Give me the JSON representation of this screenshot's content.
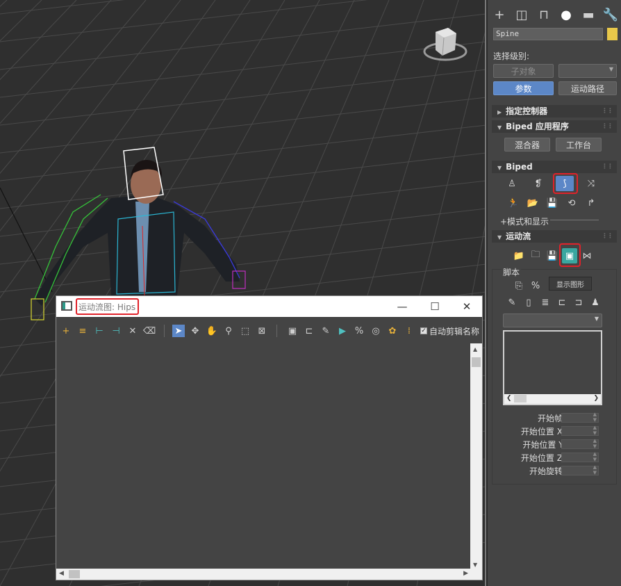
{
  "motion_flow_window": {
    "title": "运动流图: Hips",
    "controls": {
      "minimize": "—",
      "maximize": "☐",
      "close": "✕"
    },
    "toolbar": {
      "auto_clip_name_label": "自动剪辑名称",
      "auto_clip_name_checked": true
    }
  },
  "command_panel": {
    "tabs": [
      "create-icon",
      "modify-icon",
      "hierarchy-icon",
      "motion-icon",
      "display-icon",
      "utilities-icon"
    ],
    "object_name": "Spine",
    "object_color": "#e8c84a",
    "selection_level_label": "选择级别:",
    "sub_object_button": "子对象",
    "params_button": "参数",
    "trajectory_button": "运动路径",
    "rollouts": {
      "assign_controller": "指定控制器",
      "biped_apps": "Biped 应用程序",
      "mixer_button": "混合器",
      "workbench_button": "工作台",
      "biped": "Biped",
      "modes_display": "+模式和显示",
      "motion_flow": "运动流",
      "script_label": "脚本",
      "tooltip": "显示图形"
    },
    "spinners": [
      {
        "label": "开始帧:"
      },
      {
        "label": "开始位置 X:"
      },
      {
        "label": "开始位置 Y:"
      },
      {
        "label": "开始位置 Z:"
      },
      {
        "label": "开始旋转:"
      }
    ]
  },
  "viewport": {
    "viewcube_label": "▢"
  }
}
